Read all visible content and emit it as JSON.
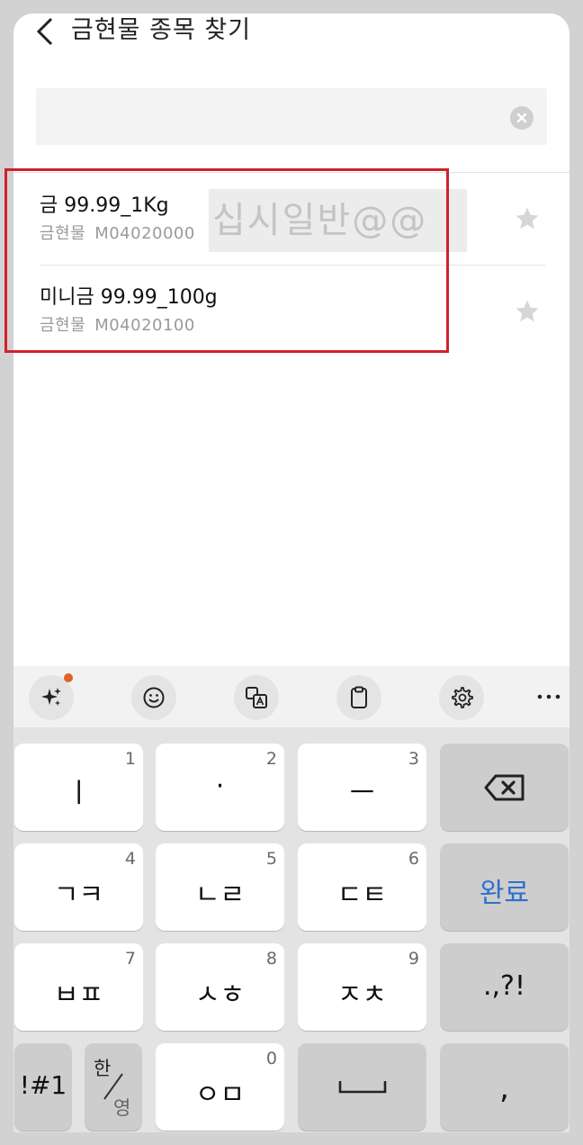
{
  "header": {
    "title": "금현물 종목 찾기",
    "back_icon": "chevron-left-icon"
  },
  "search": {
    "value": "",
    "placeholder": "",
    "clear_icon": "close-circle-icon"
  },
  "results": [
    {
      "name": "금 99.99_1Kg",
      "category": "금현물",
      "code": "M04020000",
      "star_icon": "star-icon"
    },
    {
      "name": "미니금 99.99_100g",
      "category": "금현물",
      "code": "M04020100",
      "star_icon": "star-icon"
    }
  ],
  "watermark": {
    "text": "십시일반@@"
  },
  "colors": {
    "highlight": "#d0212e",
    "ai_badge": "#e2622a",
    "done_key": "#2f6fcf"
  },
  "keyboard_toolbar": {
    "icons": [
      "sparkle-icon",
      "emoji-icon",
      "translate-icon",
      "clipboard-icon",
      "gear-icon",
      "more-icon"
    ]
  },
  "keyboard": {
    "rows": [
      [
        {
          "label": "ㅣ",
          "num": "1"
        },
        {
          "label": "·",
          "num": "2"
        },
        {
          "label": "ㅡ",
          "num": "3"
        },
        {
          "label": "",
          "icon": "backspace-icon"
        }
      ],
      [
        {
          "label": "ㄱㅋ",
          "num": "4"
        },
        {
          "label": "ㄴㄹ",
          "num": "5"
        },
        {
          "label": "ㄷㅌ",
          "num": "6"
        },
        {
          "label": "완료"
        }
      ],
      [
        {
          "label": "ㅂㅍ",
          "num": "7"
        },
        {
          "label": "ㅅㅎ",
          "num": "8"
        },
        {
          "label": "ㅈㅊ",
          "num": "9"
        },
        {
          "label": ".,?!"
        }
      ],
      [
        {
          "label": "!#1"
        },
        {
          "label_top": "한",
          "label_bottom": "영"
        },
        {
          "label": "ㅇㅁ",
          "num": "0"
        },
        {
          "label": "",
          "icon": "space-icon"
        },
        {
          "label": ","
        }
      ]
    ]
  }
}
